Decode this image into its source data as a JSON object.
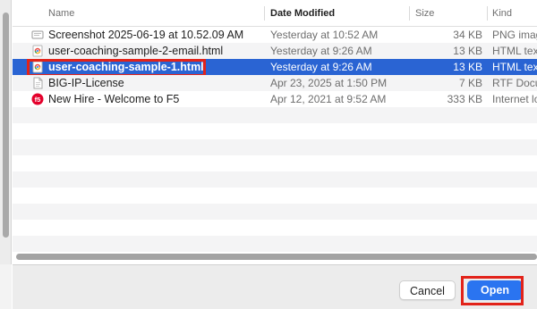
{
  "columns": {
    "name": "Name",
    "date": "Date Modified",
    "size": "Size",
    "kind": "Kind"
  },
  "files": [
    {
      "name": "Screenshot 2025-06-19 at 10.52.09 AM",
      "date": "Yesterday at 10:52 AM",
      "size": "34 KB",
      "kind": "PNG image",
      "icon": "image-file-icon"
    },
    {
      "name": "user-coaching-sample-2-email.html",
      "date": "Yesterday at 9:26 AM",
      "size": "13 KB",
      "kind": "HTML text",
      "icon": "chrome-html-icon"
    },
    {
      "name": "user-coaching-sample-1.html",
      "date": "Yesterday at 9:26 AM",
      "size": "13 KB",
      "kind": "HTML text",
      "icon": "chrome-html-icon",
      "selected": true
    },
    {
      "name": "BIG-IP-License",
      "date": "Apr 23, 2025 at 1:50 PM",
      "size": "7 KB",
      "kind": "RTF Document",
      "icon": "document-icon"
    },
    {
      "name": "New Hire - Welcome to F5",
      "date": "Apr 12, 2021 at 9:52 AM",
      "size": "333 KB",
      "kind": "Internet location",
      "icon": "f5-logo-icon"
    }
  ],
  "buttons": {
    "cancel": "Cancel",
    "open": "Open"
  },
  "colors": {
    "selection": "#2a64d3",
    "highlight_box": "#e2231a",
    "open_button": "#2a74f0"
  }
}
